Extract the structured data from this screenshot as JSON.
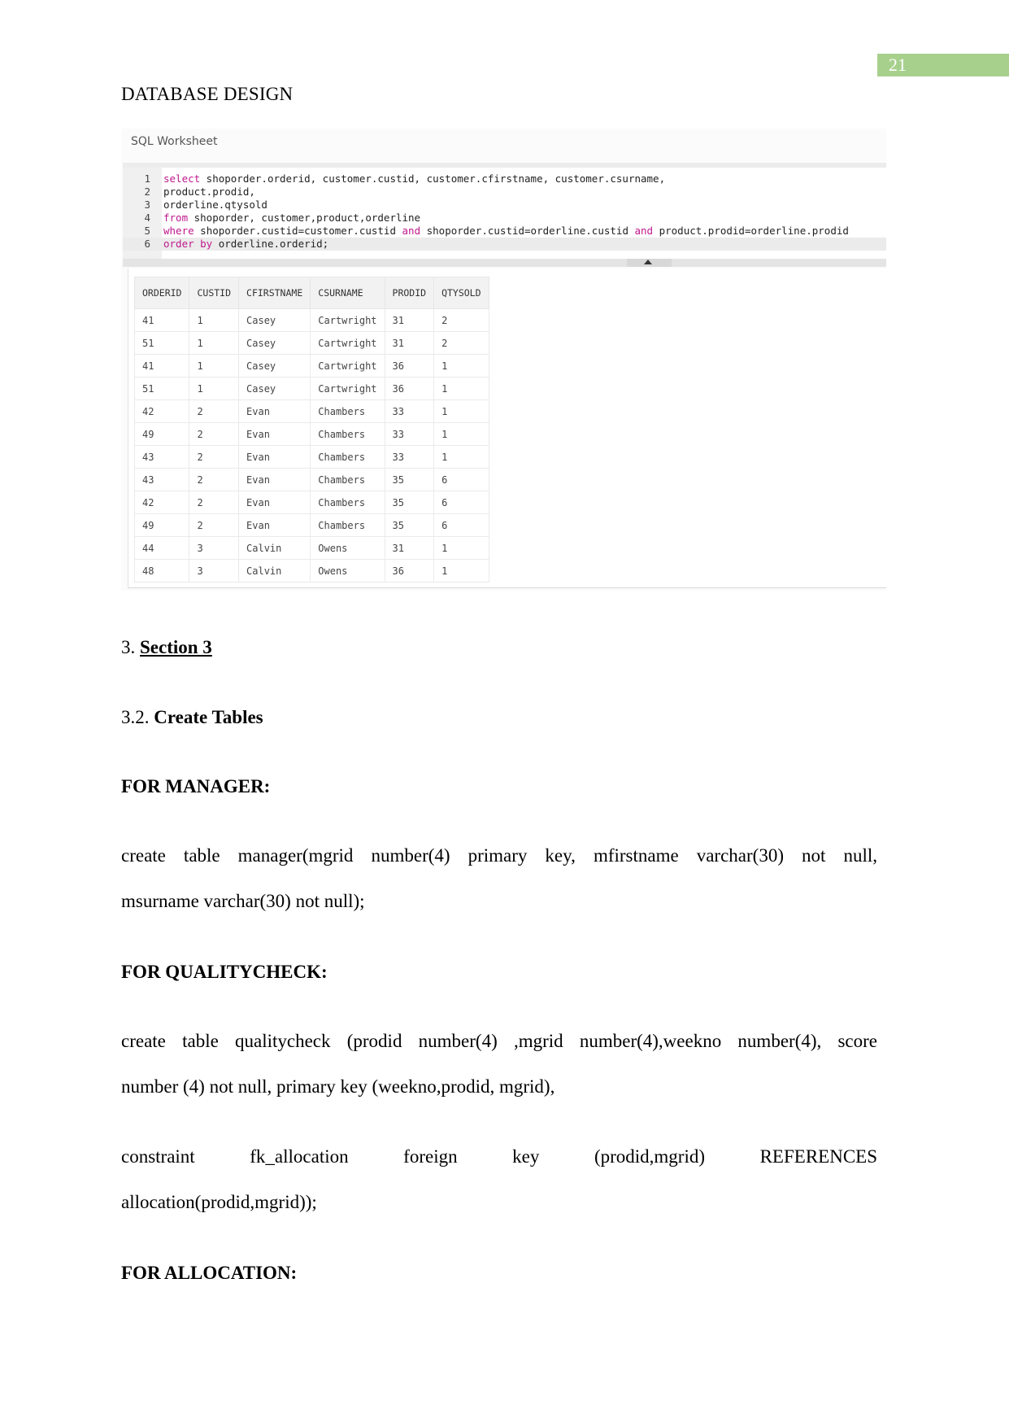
{
  "page": {
    "number": "21",
    "header_title": "DATABASE DESIGN"
  },
  "worksheet": {
    "title": "SQL Worksheet",
    "code_lines": [
      {
        "n": "1",
        "kw": "select",
        "rest": " shoporder.orderid, customer.custid, customer.cfirstname, customer.csurname,"
      },
      {
        "n": "2",
        "kw": "",
        "rest": "product.prodid,"
      },
      {
        "n": "3",
        "kw": "",
        "rest": "orderline.qtysold"
      },
      {
        "n": "4",
        "kw": "from",
        "rest": " shoporder, customer,product,orderline"
      },
      {
        "n": "5",
        "kw": "where",
        "rest": " shoporder.custid=customer.custid ",
        "kw2": "and",
        "rest2": " shoporder.custid=orderline.custid ",
        "kw3": "and",
        "rest3": " product.prodid=orderline.prodid"
      },
      {
        "n": "6",
        "kw": "order by",
        "rest": " orderline.orderid;"
      }
    ],
    "results": {
      "columns": [
        "ORDERID",
        "CUSTID",
        "CFIRSTNAME",
        "CSURNAME",
        "PRODID",
        "QTYSOLD"
      ],
      "rows": [
        [
          "41",
          "1",
          "Casey",
          "Cartwright",
          "31",
          "2"
        ],
        [
          "51",
          "1",
          "Casey",
          "Cartwright",
          "31",
          "2"
        ],
        [
          "41",
          "1",
          "Casey",
          "Cartwright",
          "36",
          "1"
        ],
        [
          "51",
          "1",
          "Casey",
          "Cartwright",
          "36",
          "1"
        ],
        [
          "42",
          "2",
          "Evan",
          "Chambers",
          "33",
          "1"
        ],
        [
          "49",
          "2",
          "Evan",
          "Chambers",
          "33",
          "1"
        ],
        [
          "43",
          "2",
          "Evan",
          "Chambers",
          "33",
          "1"
        ],
        [
          "43",
          "2",
          "Evan",
          "Chambers",
          "35",
          "6"
        ],
        [
          "42",
          "2",
          "Evan",
          "Chambers",
          "35",
          "6"
        ],
        [
          "49",
          "2",
          "Evan",
          "Chambers",
          "35",
          "6"
        ],
        [
          "44",
          "3",
          "Calvin",
          "Owens",
          "31",
          "1"
        ],
        [
          "48",
          "3",
          "Calvin",
          "Owens",
          "36",
          "1"
        ]
      ]
    }
  },
  "sections": {
    "section3_prefix": "3. ",
    "section3_title": "Section 3",
    "sub_prefix": "3.2. ",
    "sub_title": "Create Tables",
    "manager_heading": "FOR MANAGER:",
    "manager_line1": "create table manager(mgrid number(4) primary key, mfirstname varchar(30) not null,",
    "manager_line2": "msurname varchar(30) not null);",
    "qc_heading": "FOR QUALITYCHECK:",
    "qc_line1": "create table qualitycheck (prodid number(4) ,mgrid number(4),weekno number(4), score",
    "qc_line2": "number (4) not null, primary key (weekno,prodid, mgrid),",
    "constraint_line1": "constraint fk_allocation foreign key (prodid,mgrid) REFERENCES",
    "constraint_line2": "allocation(prodid,mgrid));",
    "allocation_heading": "FOR ALLOCATION:"
  }
}
